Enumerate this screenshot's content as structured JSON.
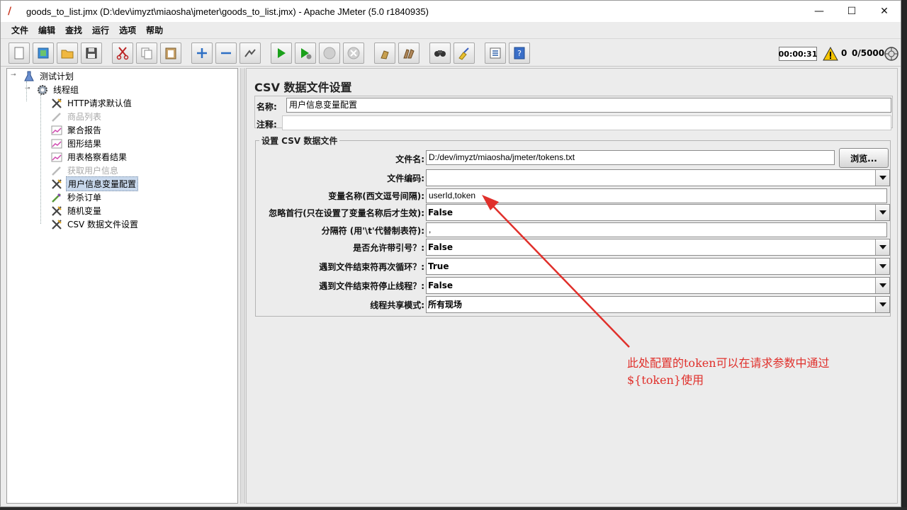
{
  "window": {
    "title": "goods_to_list.jmx (D:\\dev\\imyzt\\miaosha\\jmeter\\goods_to_list.jmx) - Apache JMeter (5.0 r1840935)",
    "controls": {
      "minimize": "—",
      "maximize": "☐",
      "close": "✕"
    }
  },
  "menu": [
    "文件",
    "编辑",
    "查找",
    "运行",
    "选项",
    "帮助"
  ],
  "toolbar": {
    "buttons": [
      "new-icon",
      "templates-icon",
      "open-icon",
      "save-icon",
      "cut-icon",
      "copy-icon",
      "paste-icon",
      "expand-icon",
      "collapse-icon",
      "toggle-icon",
      "start-icon",
      "start-no-pause-icon",
      "stop-icon",
      "shutdown-icon",
      "clear-icon",
      "clear-all-icon",
      "search-icon",
      "reset-search-icon",
      "function-helper-icon",
      "help-icon"
    ],
    "timer": "00:00:31",
    "error_count": "0",
    "threads": "0/5000"
  },
  "tree": {
    "root": "测试计划",
    "group": "线程组",
    "items": [
      {
        "label": "HTTP请求默认值",
        "icon": "wrench-icon",
        "disabled": false,
        "selected": false
      },
      {
        "label": "商品列表",
        "icon": "pipette-icon",
        "disabled": true,
        "selected": false
      },
      {
        "label": "聚合报告",
        "icon": "chart-icon",
        "disabled": false,
        "selected": false
      },
      {
        "label": "图形结果",
        "icon": "chart-icon",
        "disabled": false,
        "selected": false
      },
      {
        "label": "用表格察看结果",
        "icon": "chart-icon",
        "disabled": false,
        "selected": false
      },
      {
        "label": "获取用户信息",
        "icon": "pipette-icon",
        "disabled": true,
        "selected": false
      },
      {
        "label": "用户信息变量配置",
        "icon": "wrench-icon",
        "disabled": false,
        "selected": true
      },
      {
        "label": "秒杀订单",
        "icon": "pipette-icon",
        "disabled": false,
        "selected": false
      },
      {
        "label": "随机变量",
        "icon": "wrench-icon",
        "disabled": false,
        "selected": false
      },
      {
        "label": "CSV 数据文件设置",
        "icon": "wrench-icon",
        "disabled": false,
        "selected": false
      }
    ]
  },
  "panel": {
    "title": "CSV 数据文件设置",
    "name_label": "名称:",
    "name_value": "用户信息变量配置",
    "comment_label": "注释:",
    "comment_value": "",
    "group_title": "设置 CSV 数据文件",
    "filename_label": "文件名:",
    "filename_value": "D:/dev/imyzt/miaosha/jmeter/tokens.txt",
    "browse_label": "浏览...",
    "encoding_label": "文件编码:",
    "encoding_value": "",
    "varnames_label": "变量名称(西文逗号间隔):",
    "varnames_value": "userId,token",
    "ignore_first_label": "忽略首行(只在设置了变量名称后才生效):",
    "ignore_first_value": "False",
    "delimiter_label": "分隔符 (用'\\t'代替制表符):",
    "delimiter_value": ",",
    "quoted_label": "是否允许带引号？:",
    "quoted_value": "False",
    "recycle_label": "遇到文件结束符再次循环？:",
    "recycle_value": "True",
    "stop_thread_label": "遇到文件结束符停止线程？:",
    "stop_thread_value": "False",
    "sharing_label": "线程共享模式:",
    "sharing_value": "所有现场"
  },
  "annotation": {
    "line1": "此处配置的token可以在请求参数中通过",
    "line2": "${token}使用",
    "color": "#e0302b"
  }
}
